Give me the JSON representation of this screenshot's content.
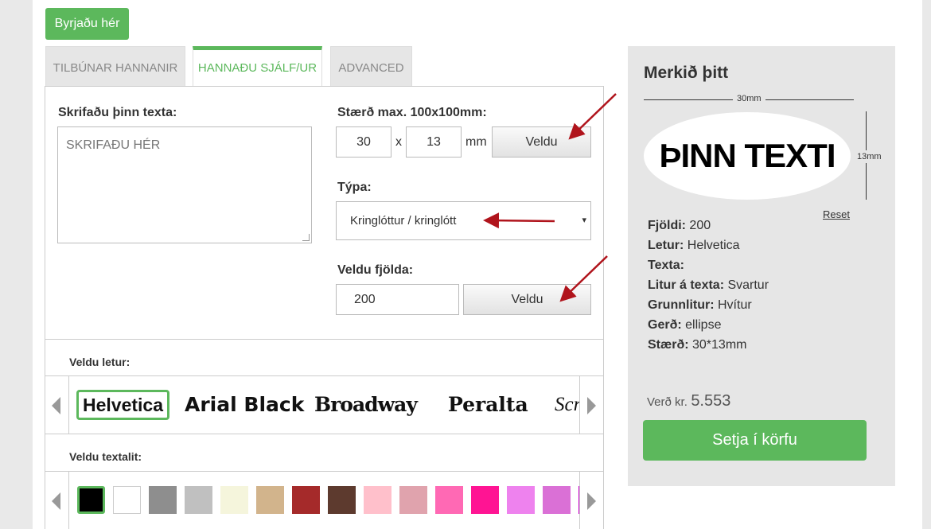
{
  "start_button": "Byrjaðu hér",
  "tabs": [
    "TILBÚNAR HANNANIR",
    "HANNAÐU SJÁLF/UR",
    "ADVANCED"
  ],
  "text_section": {
    "label": "Skrifaðu þinn texta:",
    "placeholder": "SKRIFAÐU HÉR"
  },
  "size_section": {
    "label": "Stærð max. 100x100mm:",
    "width": "30",
    "separator": "x",
    "height": "13",
    "unit": "mm",
    "button": "Veldu"
  },
  "type_section": {
    "label": "Týpa:",
    "selected": "Kringlóttur / kringlótt",
    "caret": "▾"
  },
  "quantity_section": {
    "label": "Veldu fjölda:",
    "value": "200",
    "button": "Veldu"
  },
  "font_section": {
    "label": "Veldu letur:",
    "fonts": [
      "Helvetica",
      "Arial Black",
      "Broadway",
      "Peralta",
      "Scr"
    ]
  },
  "color_section": {
    "label": "Veldu textalit:",
    "swatches": [
      "#000000",
      "#ffffff",
      "#8e8e8e",
      "#c0c0c0",
      "#f5f5dc",
      "#d2b48c",
      "#a52a2a",
      "#5d3a2e",
      "#ffc0cb",
      "#e0a3ad",
      "#ff69b4",
      "#ff1493",
      "#ee82ee",
      "#da70d6",
      "#cc00cc"
    ]
  },
  "preview": {
    "title": "Merkið þitt",
    "width_label": "30mm",
    "height_label": "13mm",
    "sample_text": "ÞINN TEXTI",
    "reset": "Reset",
    "details": [
      {
        "key": "Fjöldi:",
        "value": " 200"
      },
      {
        "key": "Letur:",
        "value": " Helvetica"
      },
      {
        "key": "Texta:",
        "value": ""
      },
      {
        "key": "Litur á texta:",
        "value": " Svartur"
      },
      {
        "key": "Grunnlitur:",
        "value": " Hvítur"
      },
      {
        "key": "Gerð:",
        "value": " ellipse"
      },
      {
        "key": "Stærð:",
        "value": " 30*13mm"
      }
    ],
    "price_label": "Verð kr.",
    "price_value": "5.553",
    "cart_button": "Setja í körfu"
  },
  "colors": {
    "accent": "#5cb85c",
    "arrow": "#b0141c",
    "panel_bg": "#e6e6e6"
  }
}
